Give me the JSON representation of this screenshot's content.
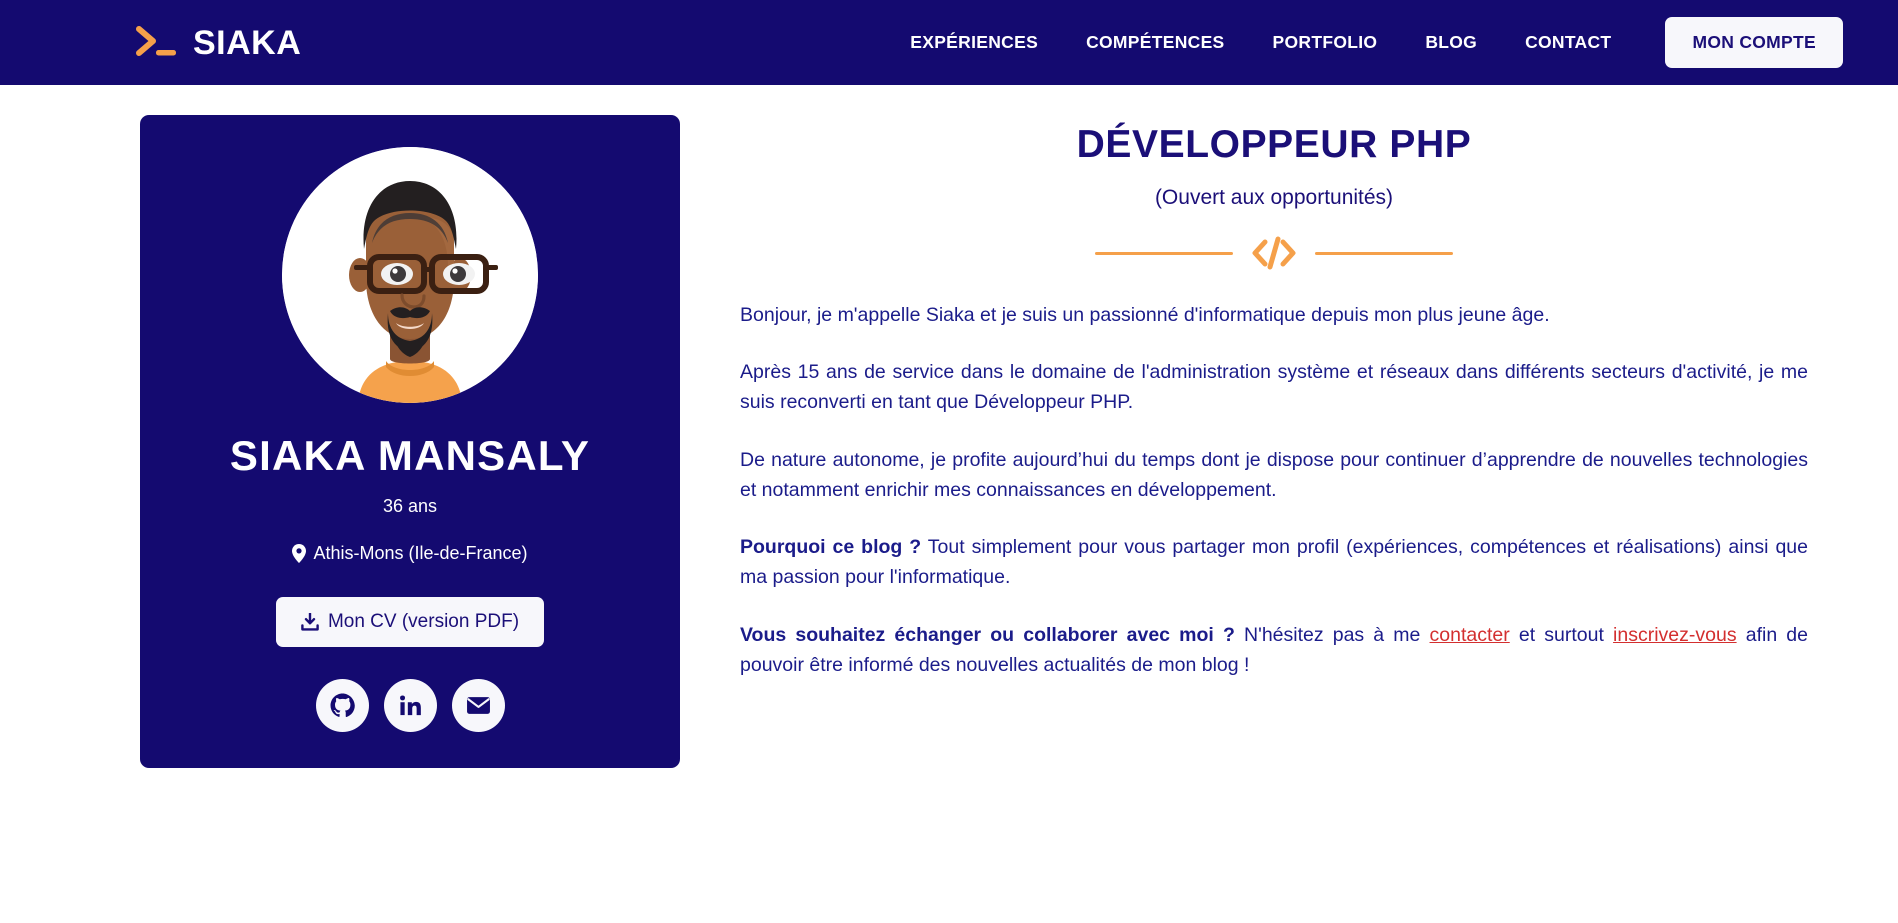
{
  "header": {
    "logo_icon": "terminal-prompt-icon",
    "brand_name": "SIAKA",
    "nav": [
      {
        "label": "EXPÉRIENCES",
        "name": "experiences"
      },
      {
        "label": "COMPÉTENCES",
        "name": "competences"
      },
      {
        "label": "PORTFOLIO",
        "name": "portfolio"
      },
      {
        "label": "BLOG",
        "name": "blog"
      },
      {
        "label": "CONTACT",
        "name": "contact"
      }
    ],
    "account_button": "MON COMPTE"
  },
  "profile": {
    "avatar_icon": "avatar-illustration",
    "name": "SIAKA MANSALY",
    "age": "36 ans",
    "location_icon": "map-marker-icon",
    "location": "Athis-Mons (Ile-de-France)",
    "cv_button": "Mon CV (version PDF)",
    "cv_icon": "download-icon",
    "socials": [
      {
        "name": "github",
        "icon": "github-icon"
      },
      {
        "name": "linkedin",
        "icon": "linkedin-icon"
      },
      {
        "name": "email",
        "icon": "envelope-icon"
      }
    ]
  },
  "main": {
    "title": "DÉVELOPPEUR PHP",
    "subtitle": "(Ouvert aux opportunités)",
    "divider_icon": "code-tag-icon",
    "paragraphs": {
      "p1": "Bonjour, je m'appelle Siaka et je suis un passionné d'informatique depuis mon plus jeune âge.",
      "p2": "Après 15 ans de service dans le domaine de l'administration système et réseaux dans différents secteurs d'activité, je me suis reconverti en tant que Développeur PHP.",
      "p3": "De nature autonome, je profite aujourd’hui du temps dont je dispose pour continuer d’apprendre de nouvelles technologies et notamment enrichir mes connaissances en développement.",
      "p4_strong": "Pourquoi ce blog ?",
      "p4_rest": " Tout simplement pour vous partager mon profil (expériences, compétences et réalisations) ainsi que ma passion pour l'informatique.",
      "p5_strong": "Vous souhaitez échanger ou collaborer avec moi ?",
      "p5_mid": " N'hésitez pas à me ",
      "p5_link1": "contacter",
      "p5_mid2": " et surtout ",
      "p5_link2": "inscrivez-vous",
      "p5_end": " afin de pouvoir être informé des nouvelles actualités de mon blog !"
    }
  },
  "colors": {
    "navy": "#140a70",
    "navy_text": "#1b0f78",
    "orange": "#f5a04a",
    "body_text": "#1b1c8a",
    "link_red": "#d32f2f",
    "white": "#ffffff"
  }
}
